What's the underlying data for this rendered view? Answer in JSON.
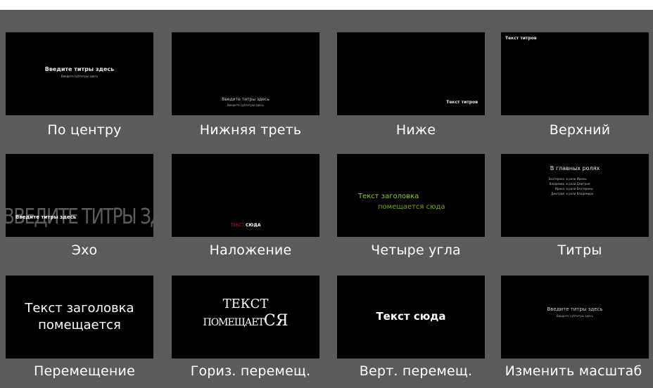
{
  "tiles": [
    {
      "caption": "По центру",
      "main": "Введите титры здесь",
      "sub": "Введите субтитры здесь"
    },
    {
      "caption": "Нижняя треть",
      "main": "Введите титры здесь",
      "sub": "Введите субтитры здесь"
    },
    {
      "caption": "Ниже",
      "main": "Текст титров"
    },
    {
      "caption": "Верхний",
      "main": "Текст титров"
    },
    {
      "caption": "Эхо",
      "main": "Введите титры здесь",
      "echo": "ВВЕДИТЕ ТИТРЫ ЗДЕСЬ"
    },
    {
      "caption": "Наложение",
      "word1": "ТЕКСТ",
      "word2": "СЮДА"
    },
    {
      "caption": "Четыре угла",
      "line1": "Текст заголовка",
      "line2": "помещается сюда"
    },
    {
      "caption": "Титры",
      "heading": "В главных ролях",
      "credits": [
        {
          "name": "Екатерина",
          "role": "в роли Ирины"
        },
        {
          "name": "Владимир",
          "role": "в роли Дмитрия"
        },
        {
          "name": "Ирина",
          "role": "в роли Екатерины"
        },
        {
          "name": "Дмитрий",
          "role": "в роли Владимира"
        }
      ]
    },
    {
      "caption": "Перемещение",
      "line1": "Текст заголовка",
      "line2": "помещается"
    },
    {
      "caption": "Гориз. перемещ.",
      "line1": "ТЕКСТ",
      "line2a": "ПОМЕЩАЕТ",
      "line2b": "СЯ"
    },
    {
      "caption": "Верт. перемещ.",
      "main": "Текст сюда"
    },
    {
      "caption": "Изменить масштаб",
      "main": "Введите титры здесь",
      "sub": "Введите субтитры здесь"
    }
  ],
  "colors": {
    "background": "#5b5b5b",
    "thumb": "#000000",
    "caption": "#ffffff",
    "red": "#e01818",
    "green": "#8ccf2a"
  }
}
